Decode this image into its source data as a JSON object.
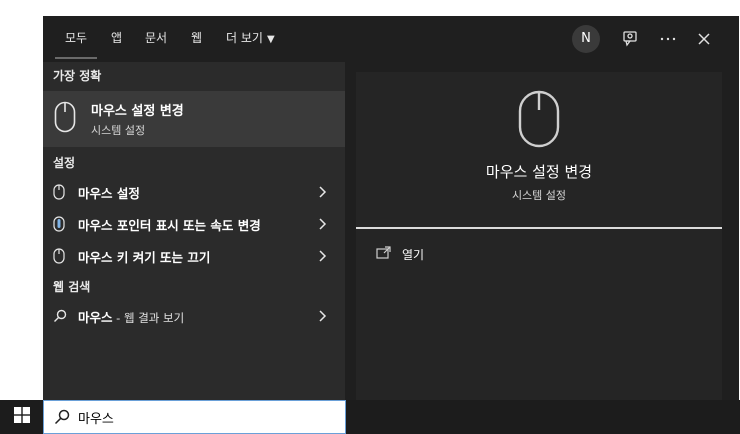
{
  "filters": {
    "tabs": [
      {
        "label": "모두",
        "active": true
      },
      {
        "label": "앱"
      },
      {
        "label": "문서"
      },
      {
        "label": "웹"
      },
      {
        "label": "더 보기"
      }
    ],
    "avatar_initial": "N"
  },
  "left": {
    "best_match": {
      "heading": "가장 정확",
      "title": "마우스 설정 변경",
      "subtitle": "시스템 설정",
      "icon": "mouse-icon"
    },
    "settings": {
      "heading": "설정",
      "items": [
        {
          "label": "마우스 설정",
          "icon": "mouse-icon"
        },
        {
          "label": "마우스 포인터 표시 또는 속도 변경",
          "icon": "mouse-pointer-icon"
        },
        {
          "label": "마우스 키 켜기 또는 끄기",
          "icon": "mouse-icon"
        }
      ]
    },
    "web": {
      "heading": "웹 검색",
      "items": [
        {
          "query": "마우스",
          "suffix": " - 웹 결과 보기",
          "icon": "search-icon"
        }
      ]
    }
  },
  "preview": {
    "title": "마우스 설정 변경",
    "subtitle": "시스템 설정",
    "actions": [
      {
        "label": "열기",
        "icon": "open-icon"
      }
    ]
  },
  "search": {
    "value": "마우스"
  },
  "colors": {
    "panel": "#1f1f1f",
    "left_bg": "#2b2b2b",
    "selected": "#3a3a3a",
    "preview_bg": "#252525"
  }
}
